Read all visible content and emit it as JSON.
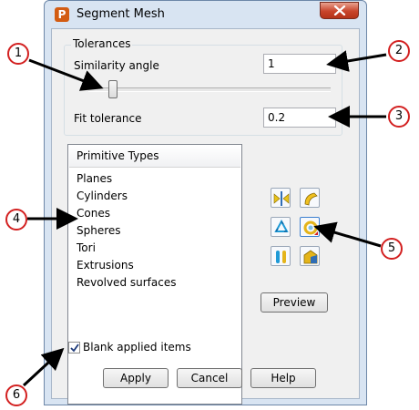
{
  "window": {
    "title": "Segment Mesh",
    "app_icon_letter": "P"
  },
  "tolerances": {
    "legend": "Tolerances",
    "similarity_label": "Similarity angle",
    "similarity_value": "1",
    "fit_label": "Fit tolerance",
    "fit_value": "0.2",
    "slider_fraction": 0.1
  },
  "primitive_list": {
    "header": "Primitive Types",
    "items": [
      "Planes",
      "Cylinders",
      "Cones",
      "Spheres",
      "Tori",
      "Extrusions",
      "Revolved surfaces"
    ]
  },
  "tools": {
    "icons": [
      "mirror-split-icon",
      "curved-surface-icon",
      "recycle-icon",
      "ring-target-icon",
      "probe-icon",
      "shape-fill-icon"
    ]
  },
  "preview_label": "Preview",
  "blank_applied": {
    "label": "Blank applied items",
    "checked": true
  },
  "buttons": {
    "apply": "Apply",
    "cancel": "Cancel",
    "help": "Help"
  },
  "callouts": [
    "1",
    "2",
    "3",
    "4",
    "5",
    "6"
  ],
  "colors": {
    "callout_border": "#d32020",
    "close_button": "#c8442a",
    "frame": "#d8e4f2"
  }
}
